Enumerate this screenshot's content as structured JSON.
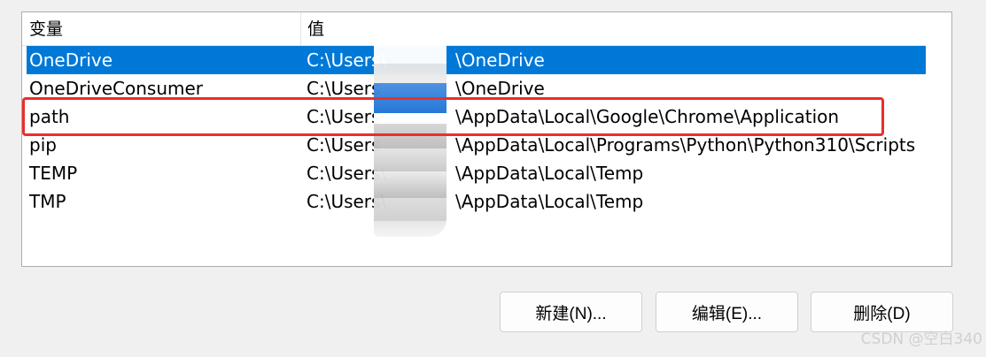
{
  "table": {
    "headers": {
      "variable": "变量",
      "value": "值"
    },
    "rows": [
      {
        "name": "OneDrive",
        "value": "C:\\Users\\",
        "value_suffix": "\\OneDrive",
        "selected": true
      },
      {
        "name": "OneDriveConsumer",
        "value": "C:\\Users",
        "value_suffix": "\\OneDrive",
        "selected": false
      },
      {
        "name": "path",
        "value": "C:\\Users",
        "value_suffix": "\\AppData\\Local\\Google\\Chrome\\Application",
        "selected": false
      },
      {
        "name": "pip",
        "value": "C:\\Users",
        "value_suffix": "\\AppData\\Local\\Programs\\Python\\Python310\\Scripts",
        "selected": false
      },
      {
        "name": "TEMP",
        "value": "C:\\Users\\",
        "value_suffix": "\\AppData\\Local\\Temp",
        "selected": false
      },
      {
        "name": "TMP",
        "value": "C:\\Users\\",
        "value_suffix": "\\AppData\\Local\\Temp",
        "selected": false
      }
    ]
  },
  "buttons": {
    "new_label": "新建(N)...",
    "edit_label": "编辑(E)...",
    "delete_label": "删除(D)"
  },
  "watermark": "CSDN @空白340",
  "colors": {
    "selection": "#0078d7",
    "highlight": "#e8302a"
  }
}
